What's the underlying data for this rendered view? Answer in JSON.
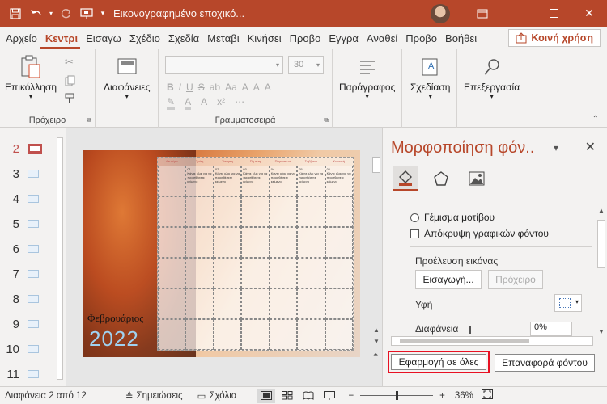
{
  "titlebar": {
    "doc_title": "Εικονογραφημένο εποχικό...",
    "icons": [
      "save-icon",
      "undo-icon",
      "redo-icon",
      "presentation-icon"
    ],
    "bg_color": "#b7472a"
  },
  "tabs": [
    "Αρχείο",
    "Κεντρι",
    "Εισαγω",
    "Σχέδιο",
    "Σχεδία",
    "Μεταβι",
    "Κινήσει",
    "Προβο",
    "Εγγρα",
    "Αναθεί",
    "Προβο",
    "Βοήθει"
  ],
  "share_label": "Κοινή χρήση",
  "ribbon": {
    "paste": "Επικόλληση",
    "clipboard": "Πρόχειρο",
    "slides": "Διαφάνειες",
    "font_size": "30",
    "font_group": "Γραμματοσειρά",
    "paragraph": "Παράγραφος",
    "drawing": "Σχεδίαση",
    "editing": "Επεξεργασία"
  },
  "thumbnails": [
    "2",
    "3",
    "4",
    "5",
    "6",
    "7",
    "8",
    "9",
    "10",
    "11"
  ],
  "slide": {
    "weekdays": [
      "Δευτέρα",
      "Τρίτη",
      "Τετάρτη",
      "Πέμπτη",
      "Παρασκευή",
      "Σάββατο",
      "Κυριακή"
    ],
    "day_numbers": [
      "01",
      "02",
      "03",
      "04",
      "05",
      "06"
    ],
    "cell_text": "Κάντε κλικ για να προσθέσετε κείμενο",
    "month": "Φεβρουάριος",
    "year": "2022"
  },
  "pane": {
    "title": "Μορφοποίηση φόν..",
    "pattern_fill": "Γέμισμα μοτίβου",
    "hide_graphics": "Απόκρυψη γραφικών φόντου",
    "picture_source": "Προέλευση εικόνας",
    "insert": "Εισαγωγή...",
    "clipboard": "Πρόχειρο",
    "texture": "Υφή",
    "transparency": "Διαφάνεια",
    "transparency_value": "0%",
    "apply_all": "Εφαρμογή σε όλες",
    "reset": "Επαναφορά φόντου"
  },
  "status": {
    "slide_info": "Διαφάνεια 2 από 12",
    "notes": "Σημειώσεις",
    "comments": "Σχόλια",
    "zoom": "36%",
    "zoom_level": 0.36
  }
}
